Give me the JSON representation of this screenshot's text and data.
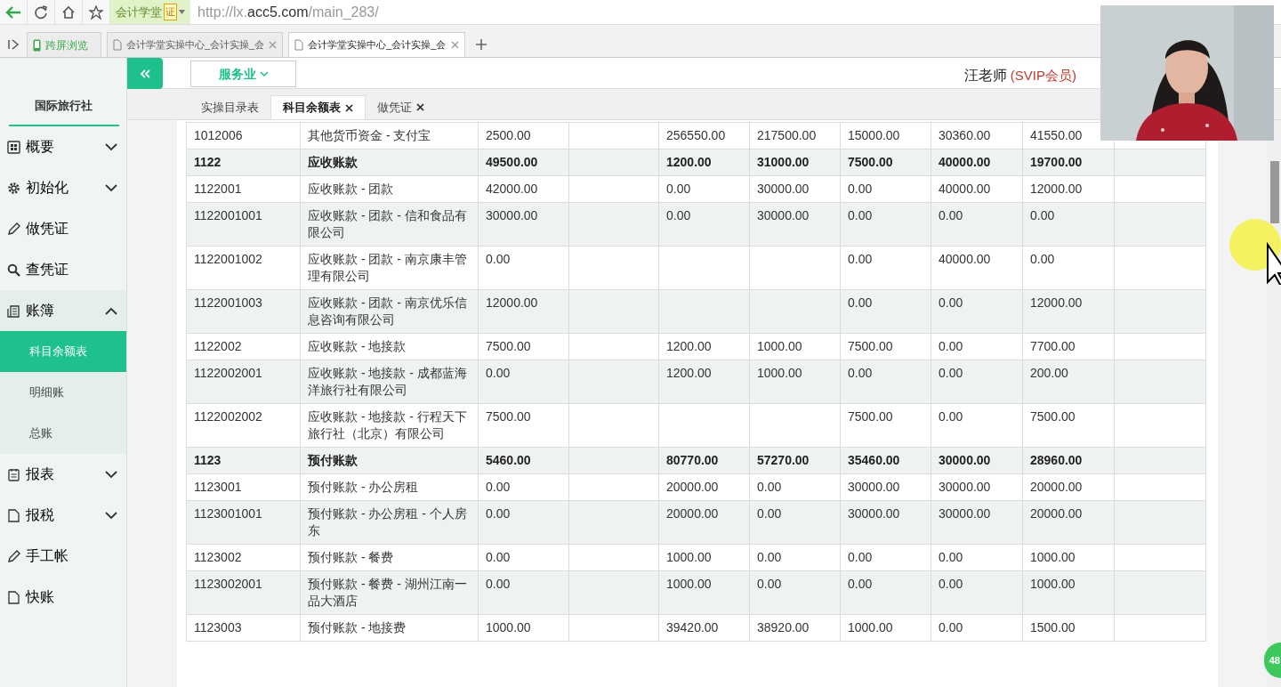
{
  "browser": {
    "app_badge": {
      "label": "会计学堂",
      "mark": "证"
    },
    "address": {
      "scheme": "http://lx.",
      "domain": "acc5.com",
      "path": "/main_283/"
    },
    "pinned_tab": {
      "label": "跨屏浏览"
    },
    "tabs": [
      {
        "title": "会计学堂实操中心_会计实操_会",
        "selected": false
      },
      {
        "title": "会计学堂实操中心_会计实操_会",
        "selected": true
      }
    ]
  },
  "sidebar": {
    "company": "国际旅行社",
    "items": [
      {
        "label": "概要",
        "expanded": false
      },
      {
        "label": "初始化",
        "expanded": false
      },
      {
        "label": "做凭证"
      },
      {
        "label": "查凭证"
      },
      {
        "label": "账簿",
        "expanded": true,
        "children": [
          {
            "label": "科目余额表",
            "selected": true
          },
          {
            "label": "明细账",
            "selected": false
          },
          {
            "label": "总账",
            "selected": false
          }
        ]
      },
      {
        "label": "报表",
        "expanded": false
      },
      {
        "label": "报税",
        "expanded": false
      },
      {
        "label": "手工帐"
      },
      {
        "label": "快账"
      }
    ]
  },
  "header": {
    "industry": "服务业",
    "user": {
      "name": "汪老师",
      "tier": "(SVIP会员)"
    }
  },
  "page_tabs": [
    {
      "label": "实操目录表",
      "selected": false,
      "closable": false
    },
    {
      "label": "科目余额表",
      "selected": true,
      "closable": true
    },
    {
      "label": "做凭证",
      "selected": false,
      "closable": true
    }
  ],
  "table": {
    "rows": [
      {
        "kind": "detail",
        "column_1": "1012006",
        "column_2": "其他货币资金 - 支付宝",
        "column_3": "2500.00",
        "column_5": "256550.00",
        "column_6": "217500.00",
        "column_7": "15000.00",
        "column_8": "30360.00",
        "column_9": "41550.00"
      },
      {
        "kind": "summary",
        "column_1": "1122",
        "column_2": "应收账款",
        "column_3": "49500.00",
        "column_5": "1200.00",
        "column_6": "31000.00",
        "column_7": "7500.00",
        "column_8": "40000.00",
        "column_9": "19700.00"
      },
      {
        "kind": "detail",
        "column_1": "1122001",
        "column_2": "应收账款 - 团款",
        "column_3": "42000.00",
        "column_5": "0.00",
        "column_6": "30000.00",
        "column_7": "0.00",
        "column_8": "40000.00",
        "column_9": "12000.00"
      },
      {
        "kind": "detail",
        "column_1": "1122001001",
        "column_2": "应收账款 - 团款 - 信和食品有限公司",
        "column_3": "30000.00",
        "column_5": "0.00",
        "column_6": "30000.00",
        "column_7": "0.00",
        "column_8": "0.00",
        "column_9": "0.00"
      },
      {
        "kind": "detail",
        "column_1": "1122001002",
        "column_2": "应收账款 - 团款 - 南京康丰管理有限公司",
        "column_3": "0.00",
        "column_7": "0.00",
        "column_8": "40000.00",
        "column_9": "0.00"
      },
      {
        "kind": "detail",
        "column_1": "1122001003",
        "column_2": "应收账款 - 团款 - 南京优乐信息咨询有限公司",
        "column_3": "12000.00",
        "column_7": "0.00",
        "column_8": "0.00",
        "column_9": "12000.00"
      },
      {
        "kind": "detail",
        "column_1": "1122002",
        "column_2": "应收账款 - 地接款",
        "column_3": "7500.00",
        "column_5": "1200.00",
        "column_6": "1000.00",
        "column_7": "7500.00",
        "column_8": "0.00",
        "column_9": "7700.00"
      },
      {
        "kind": "detail",
        "column_1": "1122002001",
        "column_2": "应收账款 - 地接款 - 成都蓝海洋旅行社有限公司",
        "column_3": "0.00",
        "column_5": "1200.00",
        "column_6": "1000.00",
        "column_7": "0.00",
        "column_8": "0.00",
        "column_9": "200.00"
      },
      {
        "kind": "detail",
        "column_1": "1122002002",
        "column_2": "应收账款 - 地接款 - 行程天下旅行社（北京）有限公司",
        "column_3": "7500.00",
        "column_7": "7500.00",
        "column_8": "0.00",
        "column_9": "7500.00"
      },
      {
        "kind": "summary",
        "column_1": "1123",
        "column_2": "预付账款",
        "column_3": "5460.00",
        "column_5": "80770.00",
        "column_6": "57270.00",
        "column_7": "35460.00",
        "column_8": "30000.00",
        "column_9": "28960.00"
      },
      {
        "kind": "detail",
        "column_1": "1123001",
        "column_2": "预付账款 - 办公房租",
        "column_3": "0.00",
        "column_5": "20000.00",
        "column_6": "0.00",
        "column_7": "30000.00",
        "column_8": "30000.00",
        "column_9": "20000.00"
      },
      {
        "kind": "detail",
        "column_1": "1123001001",
        "column_2": "预付账款 - 办公房租 - 个人房东",
        "column_3": "0.00",
        "column_5": "20000.00",
        "column_6": "0.00",
        "column_7": "30000.00",
        "column_8": "30000.00",
        "column_9": "20000.00"
      },
      {
        "kind": "detail",
        "column_1": "1123002",
        "column_2": "预付账款 - 餐费",
        "column_3": "0.00",
        "column_5": "1000.00",
        "column_6": "0.00",
        "column_7": "0.00",
        "column_8": "0.00",
        "column_9": "1000.00"
      },
      {
        "kind": "detail",
        "column_1": "1123002001",
        "column_2": "预付账款 - 餐费 - 湖州江南一品大酒店",
        "column_3": "0.00",
        "column_5": "1000.00",
        "column_6": "0.00",
        "column_7": "0.00",
        "column_8": "0.00",
        "column_9": "1000.00"
      },
      {
        "kind": "detail",
        "column_1": "1123003",
        "column_2": "预付账款 - 地接费",
        "column_3": "1000.00",
        "column_5": "39420.00",
        "column_6": "38920.00",
        "column_7": "1000.00",
        "column_8": "0.00",
        "column_9": "1500.00"
      }
    ]
  },
  "float_badge": "48"
}
